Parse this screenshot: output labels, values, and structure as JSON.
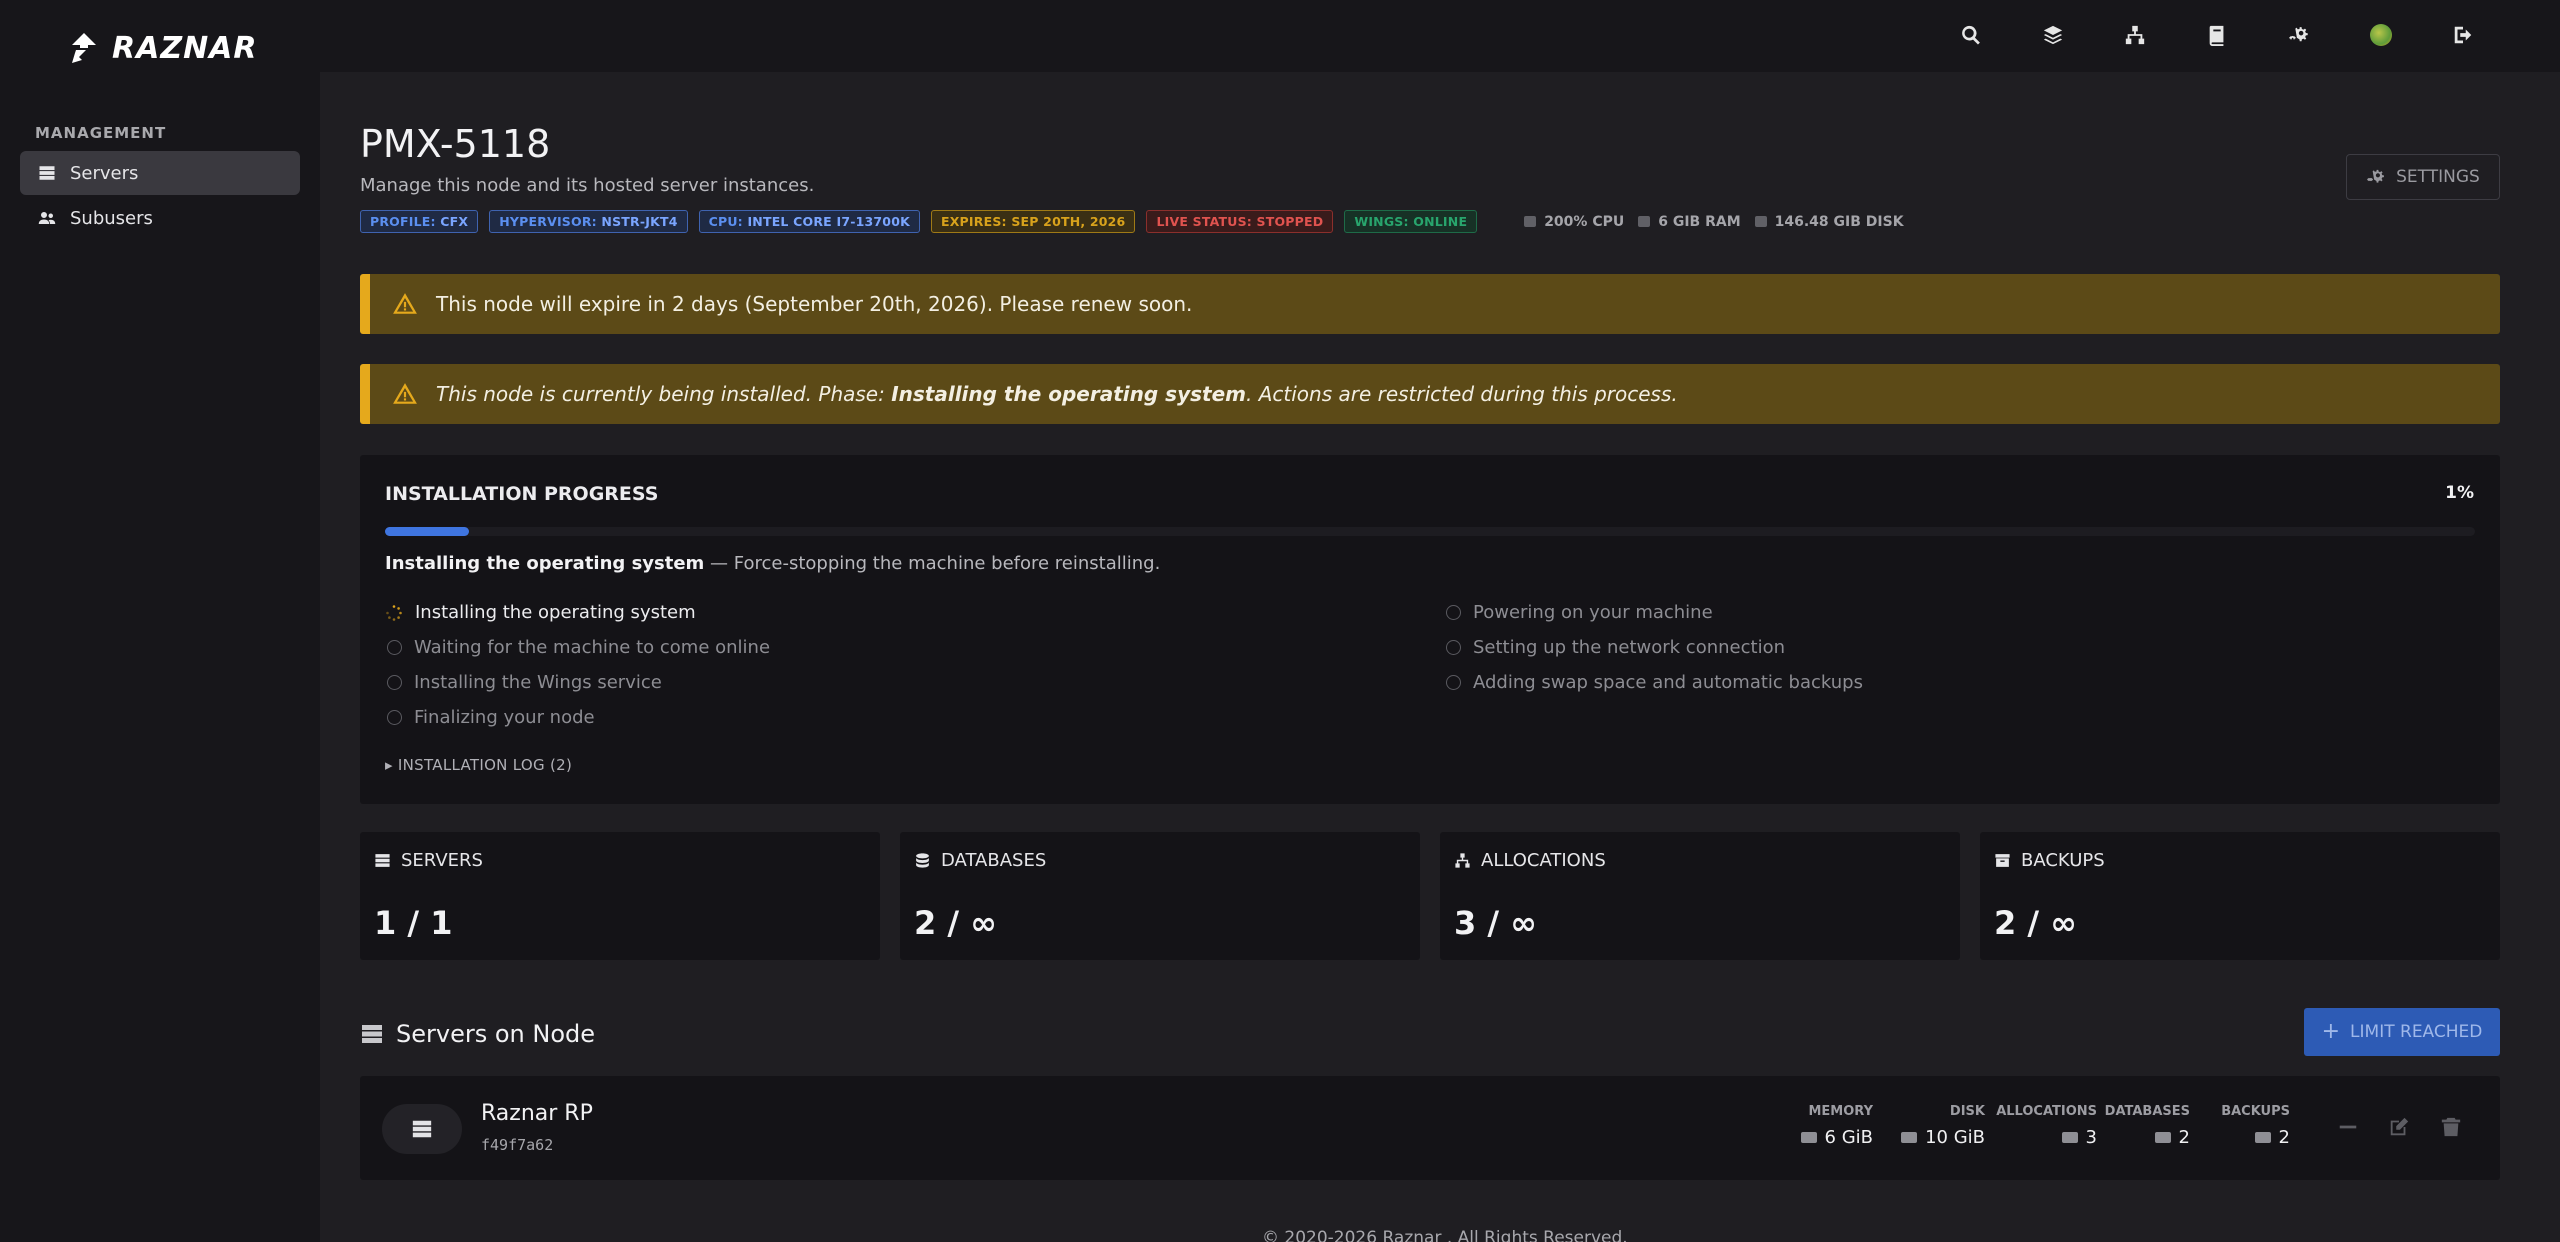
{
  "brand": {
    "name": "RAZNAR"
  },
  "topbar": {
    "icons": [
      "search-icon",
      "layers-icon",
      "sitemap-icon",
      "book-icon",
      "cogs-icon",
      "avatar",
      "sign-out-icon"
    ]
  },
  "sidebar": {
    "heading": "MANAGEMENT",
    "items": [
      {
        "label": "Servers",
        "icon": "server-icon",
        "active": true
      },
      {
        "label": "Subusers",
        "icon": "users-icon",
        "active": false
      }
    ]
  },
  "page": {
    "title": "PMX-5118",
    "subtitle": "Manage this node and its hosted server instances.",
    "settings_label": "SETTINGS",
    "badges": [
      {
        "key": "PROFILE:",
        "value": "CFX",
        "color": "#5b8ff0"
      },
      {
        "key": "HYPERVISOR:",
        "value": "NSTR-JKT4",
        "color": "#5b8ff0"
      },
      {
        "key": "CPU:",
        "value": "INTEL CORE I7-13700K",
        "color": "#5b8ff0"
      },
      {
        "key": "EXPIRES:",
        "value": "SEP 20TH, 2026",
        "color": "#d8a21c"
      },
      {
        "key": "LIVE STATUS:",
        "value": "STOPPED",
        "color": "#e0534f"
      },
      {
        "key": "WINGS:",
        "value": "ONLINE",
        "color": "#28a56d"
      }
    ],
    "resources": {
      "cpu": "200% CPU",
      "ram": "6 GIB RAM",
      "disk": "146.48 GIB DISK"
    }
  },
  "alerts": {
    "expire": "This node will expire in 2 days (September 20th, 2026). Please renew soon.",
    "install_prefix": "This node is currently being installed. Phase: ",
    "install_phase": "Installing the operating system",
    "install_suffix": ". Actions are restricted during this process."
  },
  "installation": {
    "title": "INSTALLATION PROGRESS",
    "percent_label": "1%",
    "progress_percent": 4,
    "phase_name": "Installing the operating system",
    "phase_detail": " — Force-stopping the machine before reinstalling.",
    "steps_left": [
      "Installing the operating system",
      "Waiting for the machine to come online",
      "Installing the Wings service",
      "Finalizing your node"
    ],
    "steps_right": [
      "Powering on your machine",
      "Setting up the network connection",
      "Adding swap space and automatic backups"
    ],
    "log_toggle": "▸ INSTALLATION LOG (2)"
  },
  "stats": [
    {
      "label": "SERVERS",
      "value": "1 / 1",
      "icon": "server-icon"
    },
    {
      "label": "DATABASES",
      "value": "2 / ∞",
      "icon": "database-icon"
    },
    {
      "label": "ALLOCATIONS",
      "value": "3 / ∞",
      "icon": "sitemap-icon"
    },
    {
      "label": "BACKUPS",
      "value": "2 / ∞",
      "icon": "archive-icon"
    }
  ],
  "servers_section": {
    "title": "Servers on Node",
    "limit_label": "LIMIT REACHED",
    "rows": [
      {
        "name": "Raznar RP",
        "id": "f49f7a62",
        "memory_label": "MEMORY",
        "memory": "6 GiB",
        "disk_label": "DISK",
        "disk": "10 GiB",
        "allocations_label": "ALLOCATIONS",
        "allocations": "3",
        "databases_label": "DATABASES",
        "databases": "2",
        "backups_label": "BACKUPS",
        "backups": "2"
      }
    ]
  },
  "footer": {
    "text": "© 2020-2026 Raznar . All Rights Reserved."
  }
}
